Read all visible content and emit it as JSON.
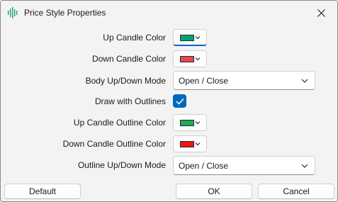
{
  "window": {
    "title": "Price Style Properties"
  },
  "rows": {
    "up_candle_color": {
      "label": "Up Candle Color",
      "color": "#00a37a"
    },
    "down_candle_color": {
      "label": "Down Candle Color",
      "color": "#e84452"
    },
    "body_mode": {
      "label": "Body Up/Down Mode",
      "value": "Open / Close"
    },
    "draw_outlines": {
      "label": "Draw with Outlines",
      "checked": true
    },
    "up_outline_color": {
      "label": "Up Candle Outline Color",
      "color": "#1faa5a"
    },
    "down_outline_color": {
      "label": "Down Candle Outline Color",
      "color": "#ef1515"
    },
    "outline_mode": {
      "label": "Outline Up/Down Mode",
      "value": "Open / Close"
    }
  },
  "buttons": {
    "default": "Default",
    "ok": "OK",
    "cancel": "Cancel"
  },
  "colors": {
    "accent": "#0067c0",
    "window_bg": "#f3f3f3"
  }
}
